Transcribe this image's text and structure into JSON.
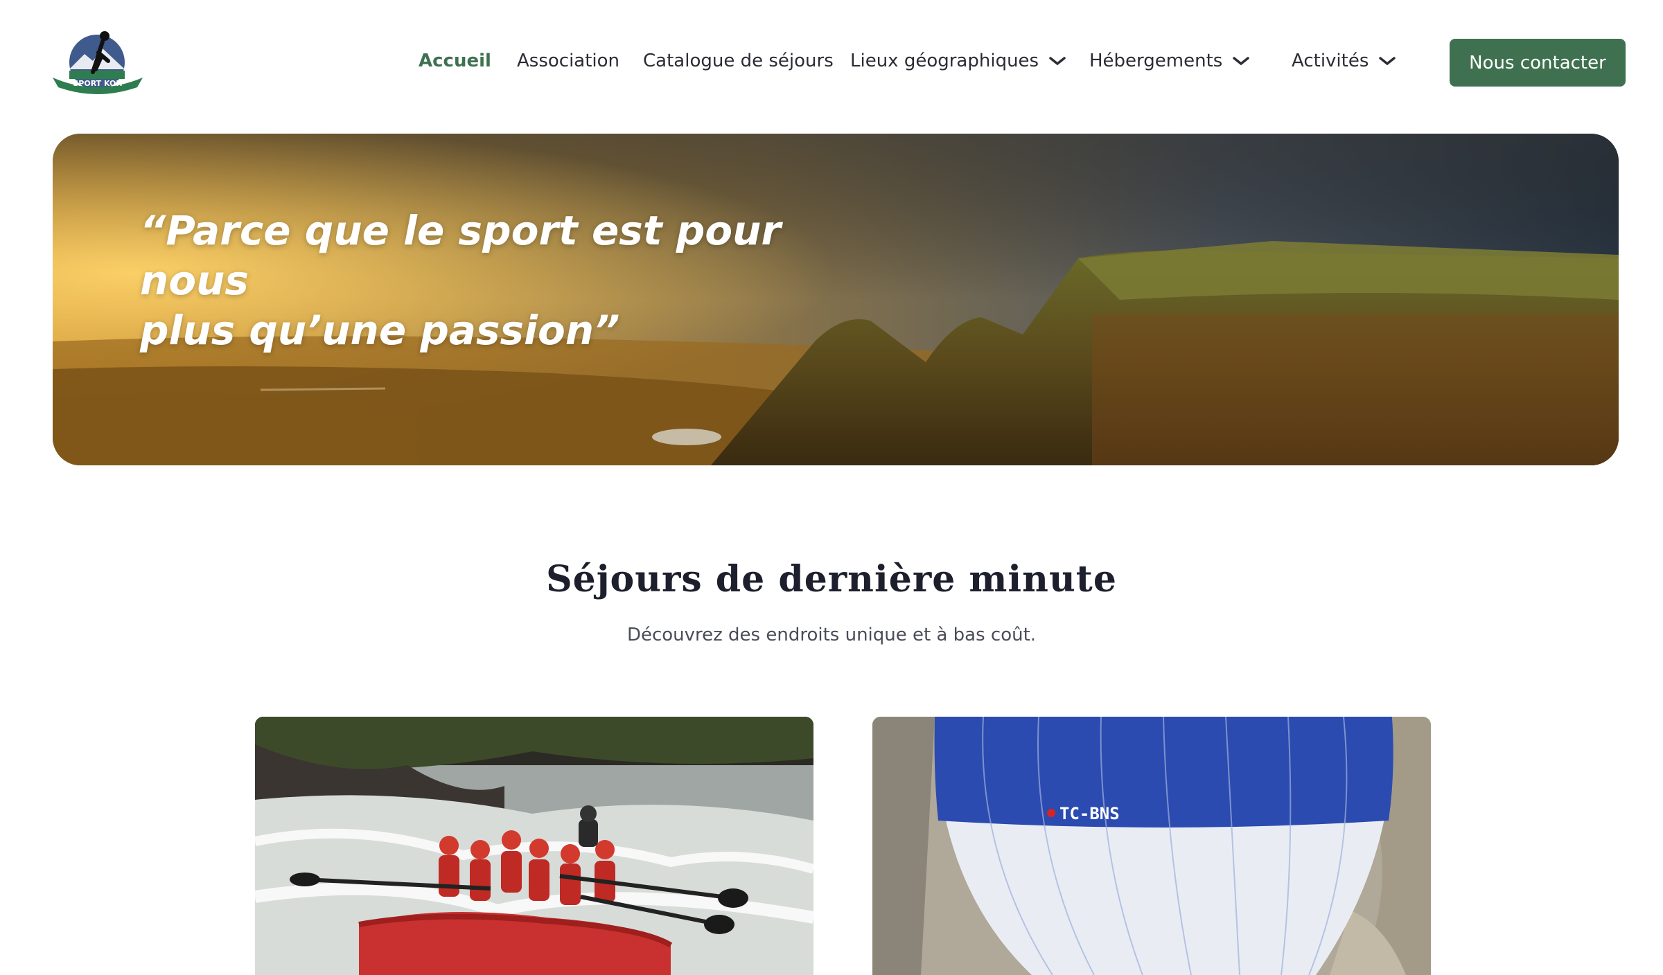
{
  "brand": {
    "logo_text": "SPORT KOH"
  },
  "nav": {
    "items": [
      {
        "label": "Accueil",
        "active": true,
        "dropdown": false
      },
      {
        "label": "Association",
        "active": false,
        "dropdown": false
      },
      {
        "label": "Catalogue de séjours",
        "active": false,
        "dropdown": false
      },
      {
        "label": "Lieux géographiques",
        "active": false,
        "dropdown": true
      },
      {
        "label": "Hébergements",
        "active": false,
        "dropdown": true
      },
      {
        "label": "Activités",
        "active": false,
        "dropdown": true
      }
    ],
    "cta_label": "Nous contacter"
  },
  "hero": {
    "quote_line1": "“Parce que le sport est pour nous",
    "quote_line2": "plus qu’une passion”"
  },
  "section": {
    "title": "Séjours de dernière minute",
    "subtitle": "Découvrez des endroits unique et à bas coût."
  },
  "cards": [
    {
      "image": "rafting-photo"
    },
    {
      "image": "hot-air-balloon-photo",
      "balloon_marking": "TC-BNS"
    }
  ],
  "colors": {
    "accent": "#3f7150",
    "text": "#2c2c35",
    "title": "#1d1f2c"
  }
}
